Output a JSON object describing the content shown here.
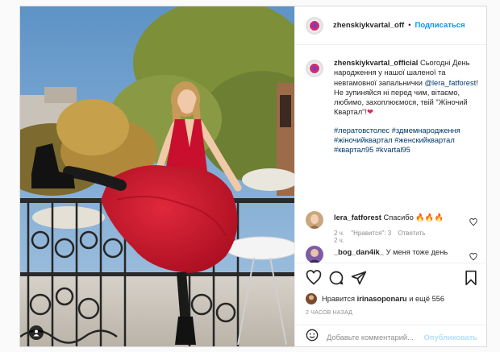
{
  "header": {
    "username": "zhenskiykvartal_off",
    "separator": "•",
    "follow_label": "Подписаться"
  },
  "caption": {
    "username": "zhenskiykvartal_official",
    "text_1": "Сьогодні День народження у нашої шаленої та невгамовної запальнички",
    "mention": "@lera_fatforest",
    "text_2": "! Не зупиняйся ні перед чим, вітаємо, любимо, захоплюємося, твій \"Жіночий Квартал\"!",
    "heart": "❤",
    "hashtags": "#лератовстолес #здмемнародження #жіночийквартал #женскийквартал #квартал95 #kvartal95",
    "time": "2 ч."
  },
  "comments": [
    {
      "username": "lera_fatforest",
      "text": "Спасибо 🔥🔥🔥",
      "time": "2 ч.",
      "likes": "\"Нравится\": 3",
      "reply": "Ответить"
    },
    {
      "username": "_bog_dan4ik_",
      "text": "У меня тоже день"
    }
  ],
  "actions": {
    "likes_prefix": "Нравится",
    "liked_by": "irinasoponaru",
    "likes_suffix": "и ещё 556",
    "ago": "2 ЧАСОВ НАЗАД",
    "comment_placeholder": "Добавьте комментарий...",
    "publish_label": "Опубликовать"
  },
  "icons": {
    "avatar": "brand-logo-avatar",
    "like": "heart-icon",
    "comment": "comment-icon",
    "share": "share-icon",
    "save": "bookmark-icon",
    "emoji": "emoji-icon",
    "tag": "person-tag-icon"
  },
  "colors": {
    "accent": "#0095f6",
    "heart": "#e0245e",
    "publish_disabled": "#b2dffc",
    "dress": "#c8102e"
  }
}
